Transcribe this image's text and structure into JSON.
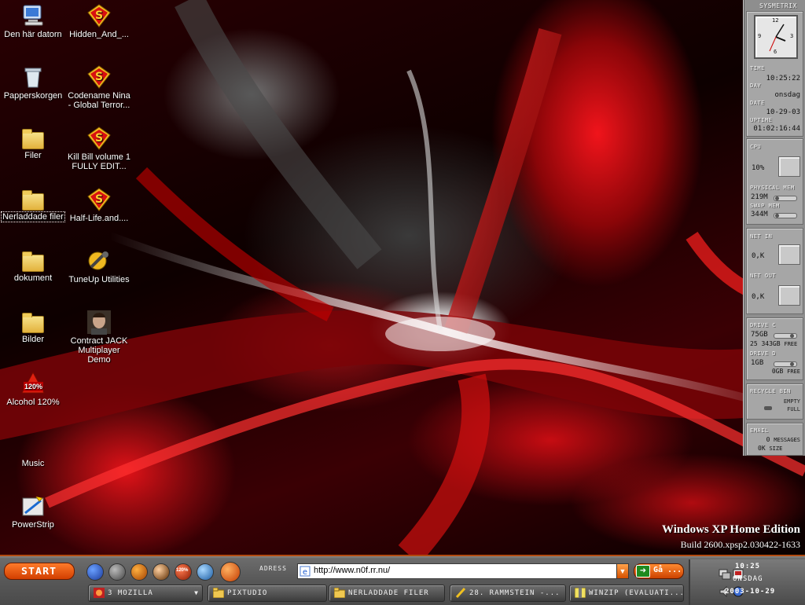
{
  "desktop": {
    "icons": [
      {
        "label": "Den här datorn",
        "icon": "my-computer-icon"
      },
      {
        "label": "Papperskorgen",
        "icon": "recycle-bin-icon"
      },
      {
        "label": "Filer",
        "icon": "folder-icon"
      },
      {
        "label": "Nerladdade filer",
        "icon": "folder-icon"
      },
      {
        "label": "dokument",
        "icon": "folder-icon"
      },
      {
        "label": "Bilder",
        "icon": "folder-icon"
      },
      {
        "label": "Alcohol 120%",
        "icon": "alcohol-120-icon",
        "badge": "120%"
      },
      {
        "label": "Music",
        "icon": "music-folder-icon"
      },
      {
        "label": "PowerStrip",
        "icon": "powerstrip-icon"
      },
      {
        "label": "Hidden_And_...",
        "icon": "s-shortcut-icon"
      },
      {
        "label": "Codename Nina - Global Terror...",
        "icon": "s-shortcut-icon"
      },
      {
        "label": "Kill Bill volume 1 FULLY EDIT...",
        "icon": "s-shortcut-icon"
      },
      {
        "label": "Half-Life.and....",
        "icon": "s-shortcut-icon"
      },
      {
        "label": "TuneUp Utilities",
        "icon": "tuneup-icon"
      },
      {
        "label": "Contract JACK Multiplayer Demo",
        "icon": "contract-jack-icon"
      }
    ]
  },
  "watermark": {
    "edition": "Windows XP Home Edition",
    "build": "Build 2600.xpsp2.030422-1633"
  },
  "sysmetrix": {
    "title": "SYSMETRIX",
    "clock_numerals": {
      "twelve": "12",
      "three": "3",
      "six": "6",
      "nine": "9"
    },
    "time_label": "TIME",
    "time": "10:25:22",
    "day_label": "DAY",
    "day": "onsdag",
    "date_label": "DATE",
    "date": "10-29-03",
    "uptime_label": "UPTIME",
    "uptime": "01:02:16:44",
    "cpu_label": "CPU",
    "cpu": "10%",
    "physmem_label": "PHYSICAL MEM",
    "physmem": "219M",
    "swapmem_label": "SWAP MEM",
    "swapmem": "344M",
    "netin_label": "NET IN",
    "netin": "0,K",
    "netout_label": "NET OUT",
    "netout": "0,K",
    "drivec_label": "DRIVE C",
    "drivec_size": "75GB",
    "drivec_free_value": "25 343GB",
    "drivec_free_label": "FREE",
    "drived_label": "DRIVE D",
    "drived_size": "1GB",
    "drived_free_value": "0GB",
    "drived_free_label": "FREE",
    "recycle_label": "RECYCLE BIN",
    "recycle_empty": "EMPTY",
    "recycle_full": "FULL",
    "email_label": "EMAIL",
    "email_count": "0",
    "email_count_label": "MESSAGES",
    "email_size": "0K",
    "email_size_label": "SIZE"
  },
  "taskbar": {
    "start_label": "START",
    "quicklaunch": [
      "ie-globe-icon",
      "media-icon",
      "tools-icon",
      "player-icon",
      "alcohol-120-icon",
      "ie-icon",
      "orange-orb-icon"
    ],
    "quicklaunch_badge": "120%",
    "address_label": "ADRESS",
    "address_value": "http://www.n0f.rr.nu/",
    "go_label": "Gå ...",
    "tasks": [
      {
        "label": "3 MOZILLA",
        "icon": "mozilla-icon"
      },
      {
        "label": "PIXTUDIO",
        "icon": "folder-icon"
      },
      {
        "label": "NERLADDADE FILER",
        "icon": "folder-icon"
      },
      {
        "label": "28. RAMMSTEIN -...",
        "icon": "winamp-icon"
      },
      {
        "label": "WINZIP (EVALUATI...",
        "icon": "winzip-icon"
      }
    ],
    "clock_time": "10:25",
    "clock_day": "ONSDAG",
    "clock_date": "2003-10-29"
  },
  "colors": {
    "accent": "#e0180f",
    "taskbar_orange": "#d13e00",
    "panel_gray": "#a6a6a6"
  }
}
